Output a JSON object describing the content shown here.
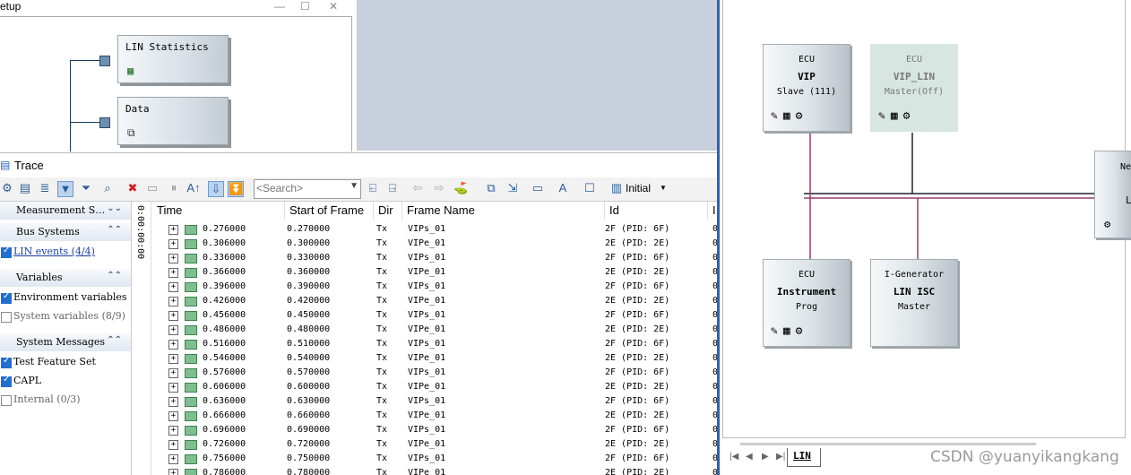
{
  "setup": {
    "title": "etup",
    "controls": [
      "—",
      "☐",
      "✕"
    ],
    "blocks": [
      {
        "label": "LIN Statistics"
      },
      {
        "label": "Data"
      }
    ]
  },
  "trace": {
    "title": "Trace",
    "search_placeholder": "<Search>",
    "initial_label": "Initial"
  },
  "filters": {
    "groups": [
      {
        "label": "Measurement S…"
      },
      {
        "label": "Bus Systems"
      },
      {
        "label": "Variables"
      },
      {
        "label": "System Messages"
      }
    ],
    "items": [
      {
        "label": "LIN events (4/4)",
        "checked": true
      },
      {
        "label": "Environment variables",
        "checked": true
      },
      {
        "label": "System variables (8/9)",
        "checked": false
      },
      {
        "label": "Test Feature Set",
        "checked": true
      },
      {
        "label": "CAPL",
        "checked": true
      },
      {
        "label": "Internal (0/3)",
        "checked": false
      }
    ]
  },
  "table": {
    "gutter_time": "0:00:00:00",
    "columns": [
      "Time",
      "Start of Frame",
      "Dir",
      "Frame Name",
      "Id",
      "I"
    ],
    "rows": [
      [
        "0.276000",
        "0.270000",
        "Tx",
        "VIPs_01",
        "2F (PID: 6F)",
        "0"
      ],
      [
        "0.306000",
        "0.300000",
        "Tx",
        "VIPe_01",
        "2E (PID: 2E)",
        "0"
      ],
      [
        "0.336000",
        "0.330000",
        "Tx",
        "VIPs_01",
        "2F (PID: 6F)",
        "0"
      ],
      [
        "0.366000",
        "0.360000",
        "Tx",
        "VIPe_01",
        "2E (PID: 2E)",
        "0"
      ],
      [
        "0.396000",
        "0.390000",
        "Tx",
        "VIPs_01",
        "2F (PID: 6F)",
        "0"
      ],
      [
        "0.426000",
        "0.420000",
        "Tx",
        "VIPe_01",
        "2E (PID: 2E)",
        "0"
      ],
      [
        "0.456000",
        "0.450000",
        "Tx",
        "VIPs_01",
        "2F (PID: 6F)",
        "0"
      ],
      [
        "0.486000",
        "0.480000",
        "Tx",
        "VIPe_01",
        "2E (PID: 2E)",
        "0"
      ],
      [
        "0.516000",
        "0.510000",
        "Tx",
        "VIPs_01",
        "2F (PID: 6F)",
        "0"
      ],
      [
        "0.546000",
        "0.540000",
        "Tx",
        "VIPe_01",
        "2E (PID: 2E)",
        "0"
      ],
      [
        "0.576000",
        "0.570000",
        "Tx",
        "VIPs_01",
        "2F (PID: 6F)",
        "0"
      ],
      [
        "0.606000",
        "0.600000",
        "Tx",
        "VIPe_01",
        "2E (PID: 2E)",
        "0"
      ],
      [
        "0.636000",
        "0.630000",
        "Tx",
        "VIPs_01",
        "2F (PID: 6F)",
        "0"
      ],
      [
        "0.666000",
        "0.660000",
        "Tx",
        "VIPe_01",
        "2E (PID: 2E)",
        "0"
      ],
      [
        "0.696000",
        "0.690000",
        "Tx",
        "VIPs_01",
        "2F (PID: 6F)",
        "0"
      ],
      [
        "0.726000",
        "0.720000",
        "Tx",
        "VIPe_01",
        "2E (PID: 2E)",
        "0"
      ],
      [
        "0.756000",
        "0.750000",
        "Tx",
        "VIPs_01",
        "2F (PID: 6F)",
        "0"
      ],
      [
        "0.786000",
        "0.780000",
        "Tx",
        "VIPe_01",
        "2E (PID: 2E)",
        "0"
      ]
    ]
  },
  "network": {
    "ecus": [
      {
        "l1": "ECU",
        "l2": "VIP",
        "l3": "Slave (111)"
      },
      {
        "l1": "ECU",
        "l2": "VIP_LIN",
        "l3": "Master(Off)"
      },
      {
        "l1": "ECU",
        "l2": "Instrument",
        "l3": "Prog"
      },
      {
        "l1": "I-Generator",
        "l2": "LIN ISC",
        "l3": "Master"
      },
      {
        "l1": "Ne",
        "l2": "L",
        "l3": ""
      }
    ],
    "tab_label": "LIN",
    "watermark": "CSDN @yuanyikangkang",
    "bus_colors": {
      "line": "#202030",
      "stub": "#9a3a6a"
    }
  }
}
